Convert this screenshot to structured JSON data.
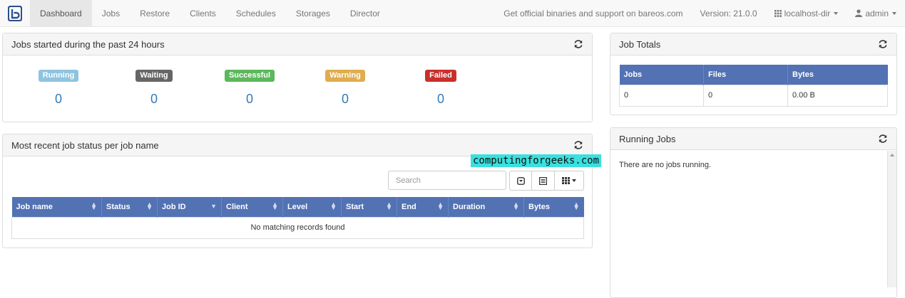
{
  "nav": {
    "items": [
      {
        "label": "Dashboard",
        "active": true
      },
      {
        "label": "Jobs"
      },
      {
        "label": "Restore"
      },
      {
        "label": "Clients"
      },
      {
        "label": "Schedules"
      },
      {
        "label": "Storages"
      },
      {
        "label": "Director"
      }
    ],
    "support_text": "Get official binaries and support on bareos.com",
    "version": "Version: 21.0.0",
    "director": "localhost-dir",
    "user": "admin",
    "brand_color": "#2d4f8c"
  },
  "jobs_24h": {
    "title": "Jobs started during the past 24 hours",
    "statuses": [
      {
        "label": "Running",
        "count": "0",
        "color": "#8ec4e0"
      },
      {
        "label": "Waiting",
        "count": "0",
        "color": "#666666"
      },
      {
        "label": "Successful",
        "count": "0",
        "color": "#5cb85c"
      },
      {
        "label": "Warning",
        "count": "0",
        "color": "#e0ad4e"
      },
      {
        "label": "Failed",
        "count": "0",
        "color": "#c9302c"
      }
    ]
  },
  "recent": {
    "title": "Most recent job status per job name",
    "search_placeholder": "Search",
    "columns": [
      "Job name",
      "Status",
      "Job ID",
      "Client",
      "Level",
      "Start",
      "End",
      "Duration",
      "Bytes"
    ],
    "empty_text": "No matching records found"
  },
  "totals": {
    "title": "Job Totals",
    "columns": [
      "Jobs",
      "Files",
      "Bytes"
    ],
    "row": [
      "0",
      "0",
      "0.00 B"
    ]
  },
  "running": {
    "title": "Running Jobs",
    "empty_text": "There are no jobs running."
  },
  "watermark": "computingforgeeks.com"
}
